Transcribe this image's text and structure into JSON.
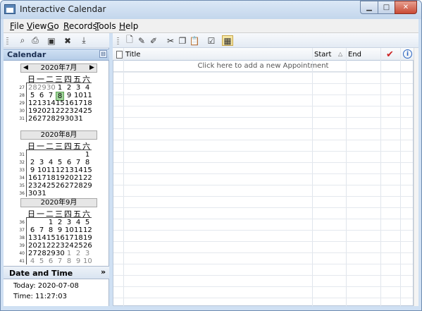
{
  "window": {
    "title": "Interactive Calendar"
  },
  "menu": [
    {
      "label": "File",
      "key": "F",
      "rest": "ile"
    },
    {
      "label": "View",
      "key": "V",
      "rest": "iew"
    },
    {
      "label": "Go",
      "key": "G",
      "rest": "o"
    },
    {
      "label": "Records",
      "key": "R",
      "rest": "ecords"
    },
    {
      "label": "Tools",
      "key": "T",
      "rest": "ools"
    },
    {
      "label": "Help",
      "key": "H",
      "rest": "elp"
    }
  ],
  "calendar_panel": {
    "title": "Calendar",
    "pin_icon": "pin-icon",
    "weekday_labels": [
      "日",
      "一",
      "二",
      "三",
      "四",
      "五",
      "六"
    ],
    "months": [
      {
        "title": "2020年7月",
        "weeks": [
          {
            "wk": "27",
            "days": [
              "28",
              "29",
              "30",
              "1",
              "2",
              "3",
              "4"
            ],
            "dim": [
              0,
              1,
              2
            ]
          },
          {
            "wk": "28",
            "days": [
              "5",
              "6",
              "7",
              "8",
              "9",
              "10",
              "11"
            ],
            "today": 3
          },
          {
            "wk": "29",
            "days": [
              "12",
              "13",
              "14",
              "15",
              "16",
              "17",
              "18"
            ]
          },
          {
            "wk": "30",
            "days": [
              "19",
              "20",
              "21",
              "22",
              "23",
              "24",
              "25"
            ]
          },
          {
            "wk": "31",
            "days": [
              "26",
              "27",
              "28",
              "29",
              "30",
              "31",
              ""
            ]
          }
        ]
      },
      {
        "title": "2020年8月",
        "weeks": [
          {
            "wk": "31",
            "days": [
              "",
              "",
              "",
              "",
              "",
              "",
              "1"
            ]
          },
          {
            "wk": "32",
            "days": [
              "2",
              "3",
              "4",
              "5",
              "6",
              "7",
              "8"
            ]
          },
          {
            "wk": "33",
            "days": [
              "9",
              "10",
              "11",
              "12",
              "13",
              "14",
              "15"
            ]
          },
          {
            "wk": "34",
            "days": [
              "16",
              "17",
              "18",
              "19",
              "20",
              "21",
              "22"
            ]
          },
          {
            "wk": "35",
            "days": [
              "23",
              "24",
              "25",
              "26",
              "27",
              "28",
              "29"
            ]
          },
          {
            "wk": "36",
            "days": [
              "30",
              "31",
              "",
              "",
              "",
              "",
              ""
            ]
          }
        ]
      },
      {
        "title": "2020年9月",
        "weeks": [
          {
            "wk": "36",
            "days": [
              "",
              "",
              "1",
              "2",
              "3",
              "4",
              "5"
            ]
          },
          {
            "wk": "37",
            "days": [
              "6",
              "7",
              "8",
              "9",
              "10",
              "11",
              "12"
            ]
          },
          {
            "wk": "38",
            "days": [
              "13",
              "14",
              "15",
              "16",
              "17",
              "18",
              "19"
            ]
          },
          {
            "wk": "39",
            "days": [
              "20",
              "21",
              "22",
              "23",
              "24",
              "25",
              "26"
            ]
          },
          {
            "wk": "40",
            "days": [
              "27",
              "28",
              "29",
              "30",
              "1",
              "2",
              "3"
            ],
            "dim": [
              4,
              5,
              6
            ]
          },
          {
            "wk": "41",
            "days": [
              "4",
              "5",
              "6",
              "7",
              "8",
              "9",
              "10"
            ],
            "dim": [
              0,
              1,
              2,
              3,
              4,
              5,
              6
            ]
          }
        ]
      }
    ]
  },
  "date_time": {
    "title": "Date and Time",
    "today": "Today: 2020-07-08",
    "time": "Time: 11:27:03"
  },
  "grid": {
    "columns": [
      "Title",
      "Start",
      "End"
    ],
    "add_row_text": "Click here to add a new Appointment"
  },
  "colors": {
    "today_highlight": "#9fd39a",
    "header_blue": "#b6cde8",
    "check_red": "#cc2222",
    "info_blue": "#2a64c0"
  }
}
